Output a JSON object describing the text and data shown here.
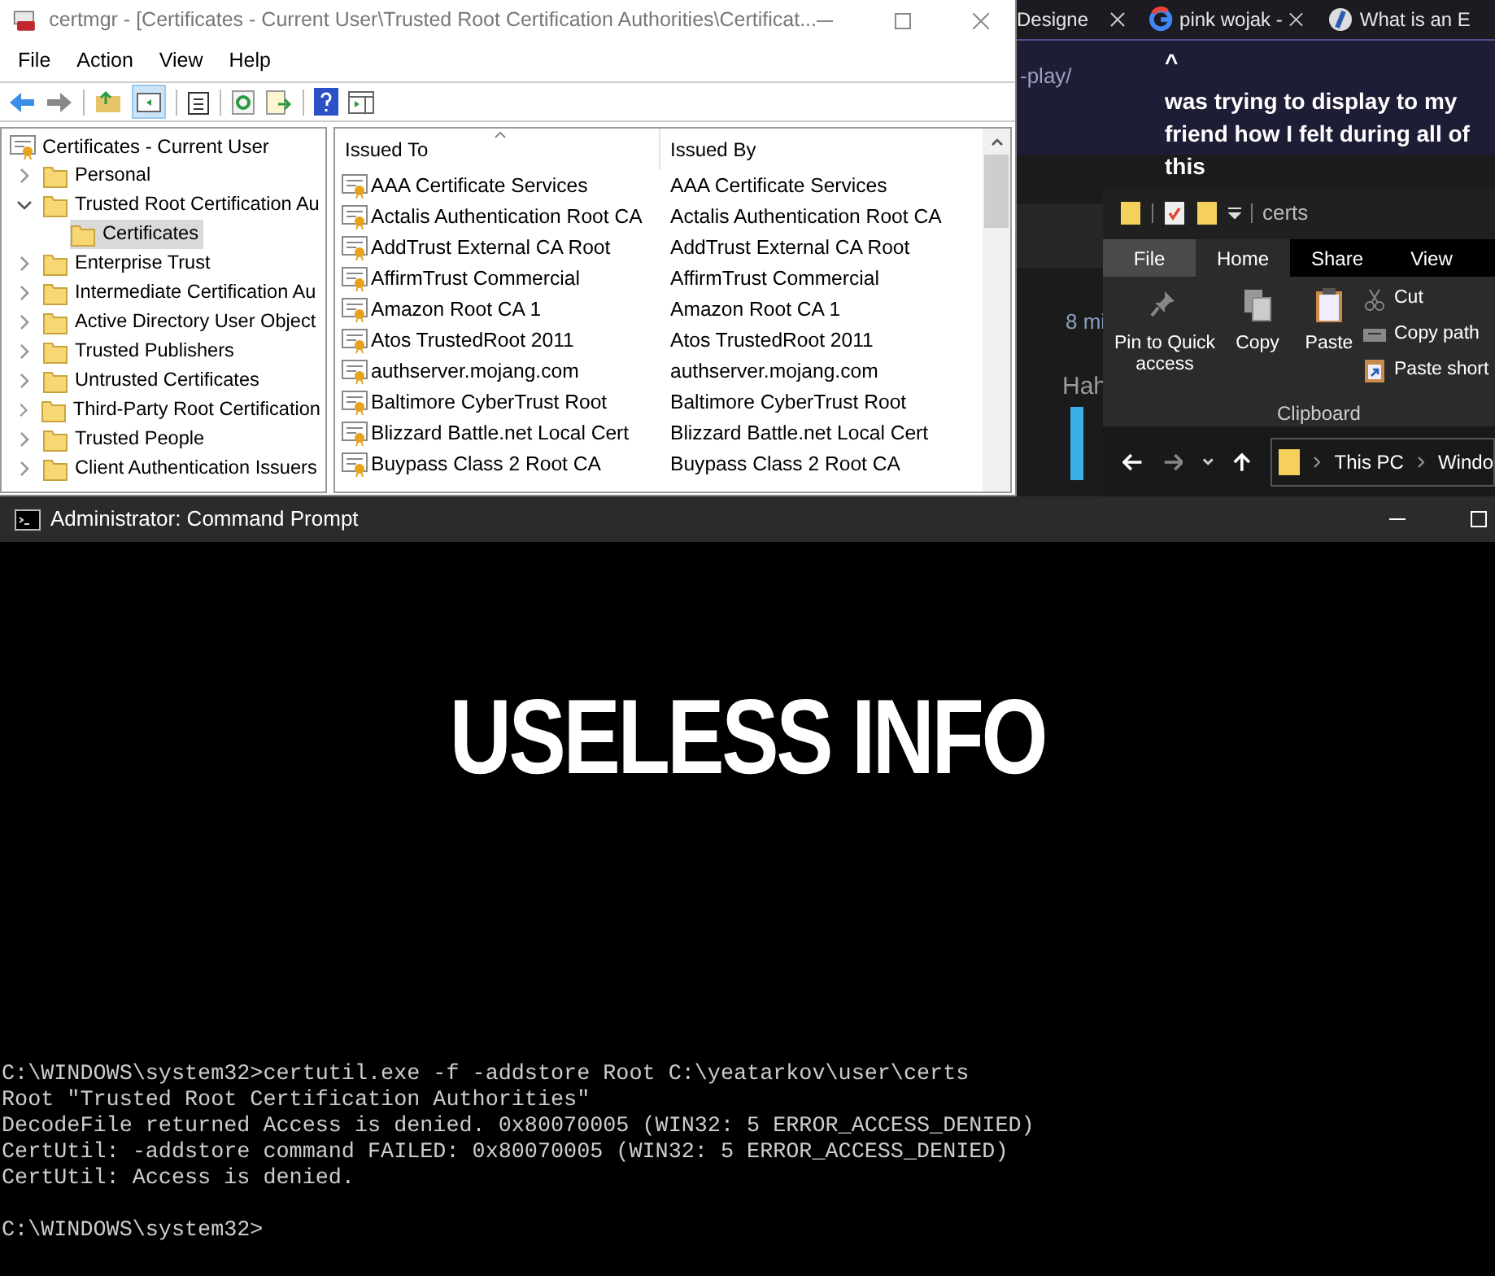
{
  "browser": {
    "tabs": [
      {
        "title": "Designe",
        "closable": true
      },
      {
        "title": "pink wojak -",
        "closable": true,
        "kind": "google"
      },
      {
        "title": "What is an E",
        "closable": false,
        "kind": "site"
      }
    ],
    "url_fragment": "-play/",
    "post_caret": "^",
    "post_text": "was trying to display to my friend how I felt during all of this",
    "timestamp": "8 mi",
    "comment": "Hah"
  },
  "certmgr": {
    "title": "certmgr - [Certificates - Current User\\Trusted Root Certification Authorities\\Certificat...",
    "menu": [
      "File",
      "Action",
      "View",
      "Help"
    ],
    "tree": {
      "label": "Certificates - Current User",
      "children": [
        {
          "label": "Personal",
          "expanded": false,
          "selected": false
        },
        {
          "label": "Trusted Root Certification Au",
          "expanded": true,
          "selected": false,
          "children": [
            {
              "label": "Certificates",
              "selected": true
            }
          ]
        },
        {
          "label": "Enterprise Trust",
          "expanded": false,
          "selected": false
        },
        {
          "label": "Intermediate Certification Au",
          "expanded": false,
          "selected": false
        },
        {
          "label": "Active Directory User Object",
          "expanded": false,
          "selected": false
        },
        {
          "label": "Trusted Publishers",
          "expanded": false,
          "selected": false
        },
        {
          "label": "Untrusted Certificates",
          "expanded": false,
          "selected": false
        },
        {
          "label": "Third-Party Root Certification",
          "expanded": false,
          "selected": false
        },
        {
          "label": "Trusted People",
          "expanded": false,
          "selected": false
        },
        {
          "label": "Client Authentication Issuers",
          "expanded": false,
          "selected": false
        }
      ]
    },
    "columns": [
      "Issued To",
      "Issued By"
    ],
    "rows": [
      {
        "issued_to": "AAA Certificate Services",
        "issued_by": "AAA Certificate Services"
      },
      {
        "issued_to": "Actalis Authentication Root CA",
        "issued_by": "Actalis Authentication Root CA"
      },
      {
        "issued_to": "AddTrust External CA Root",
        "issued_by": "AddTrust External CA Root"
      },
      {
        "issued_to": "AffirmTrust Commercial",
        "issued_by": "AffirmTrust Commercial"
      },
      {
        "issued_to": "Amazon Root CA 1",
        "issued_by": "Amazon Root CA 1"
      },
      {
        "issued_to": "Atos TrustedRoot 2011",
        "issued_by": "Atos TrustedRoot 2011"
      },
      {
        "issued_to": "authserver.mojang.com",
        "issued_by": "authserver.mojang.com"
      },
      {
        "issued_to": "Baltimore CyberTrust Root",
        "issued_by": "Baltimore CyberTrust Root"
      },
      {
        "issued_to": "Blizzard Battle.net Local Cert",
        "issued_by": "Blizzard Battle.net Local Cert"
      },
      {
        "issued_to": "Buypass Class 2 Root CA",
        "issued_by": "Buypass Class 2 Root CA"
      }
    ]
  },
  "explorer": {
    "title": "certs",
    "tabs": [
      {
        "label": "File",
        "kind": "file",
        "selected": false
      },
      {
        "label": "Home",
        "kind": "tab",
        "selected": true
      },
      {
        "label": "Share",
        "kind": "tab",
        "selected": false
      },
      {
        "label": "View",
        "kind": "tab",
        "selected": false
      }
    ],
    "big_buttons": [
      {
        "label": "Pin to Quick access",
        "kind": "pin"
      },
      {
        "label": "Copy",
        "kind": "copy"
      },
      {
        "label": "Paste",
        "kind": "paste"
      }
    ],
    "small_buttons": [
      {
        "label": "Cut",
        "kind": "cut"
      },
      {
        "label": "Copy path",
        "kind": "path"
      },
      {
        "label": "Paste short",
        "kind": "shortcut"
      }
    ],
    "group_label": "Clipboard",
    "breadcrumb": [
      "This PC",
      "Windo"
    ]
  },
  "cmd": {
    "title": "Administrator: Command Prompt",
    "overlay_text": "USELESS INFO",
    "lines": [
      "C:\\WINDOWS\\system32>certutil.exe -f -addstore Root C:\\yeatarkov\\user\\certs",
      "Root \"Trusted Root Certification Authorities\"",
      "DecodeFile returned Access is denied. 0x80070005 (WIN32: 5 ERROR_ACCESS_DENIED)",
      "CertUtil: -addstore command FAILED: 0x80070005 (WIN32: 5 ERROR_ACCESS_DENIED)",
      "CertUtil: Access is denied."
    ],
    "prompt": "C:\\WINDOWS\\system32>"
  }
}
